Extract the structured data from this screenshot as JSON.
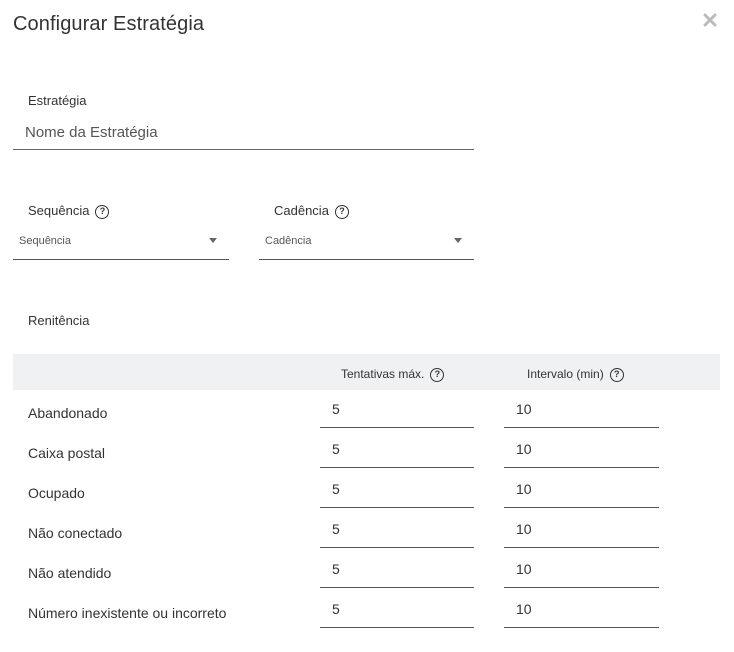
{
  "dialog": {
    "title": "Configurar Estratégia"
  },
  "strategy": {
    "label": "Estratégia",
    "placeholder": "Nome da Estratégia",
    "value": ""
  },
  "sequence": {
    "label": "Sequência",
    "selected": "Sequência"
  },
  "cadence": {
    "label": "Cadência",
    "selected": "Cadência"
  },
  "renitence": {
    "label": "Renitência",
    "columns": [
      "Tentativas máx.",
      "Intervalo (min)"
    ],
    "rows": [
      {
        "label": "Abandonado",
        "max_attempts": "5",
        "interval": "10"
      },
      {
        "label": "Caixa postal",
        "max_attempts": "5",
        "interval": "10"
      },
      {
        "label": "Ocupado",
        "max_attempts": "5",
        "interval": "10"
      },
      {
        "label": "Não conectado",
        "max_attempts": "5",
        "interval": "10"
      },
      {
        "label": "Não atendido",
        "max_attempts": "5",
        "interval": "10"
      },
      {
        "label": "Número inexistente ou incorreto",
        "max_attempts": "5",
        "interval": "10"
      }
    ]
  },
  "icons": {
    "close": "close-icon",
    "help": "help-circle-icon",
    "caret": "caret-down-icon"
  },
  "colors": {
    "table_header_bg": "#f0f1f3",
    "text": "#333333",
    "underline": "#555555"
  }
}
